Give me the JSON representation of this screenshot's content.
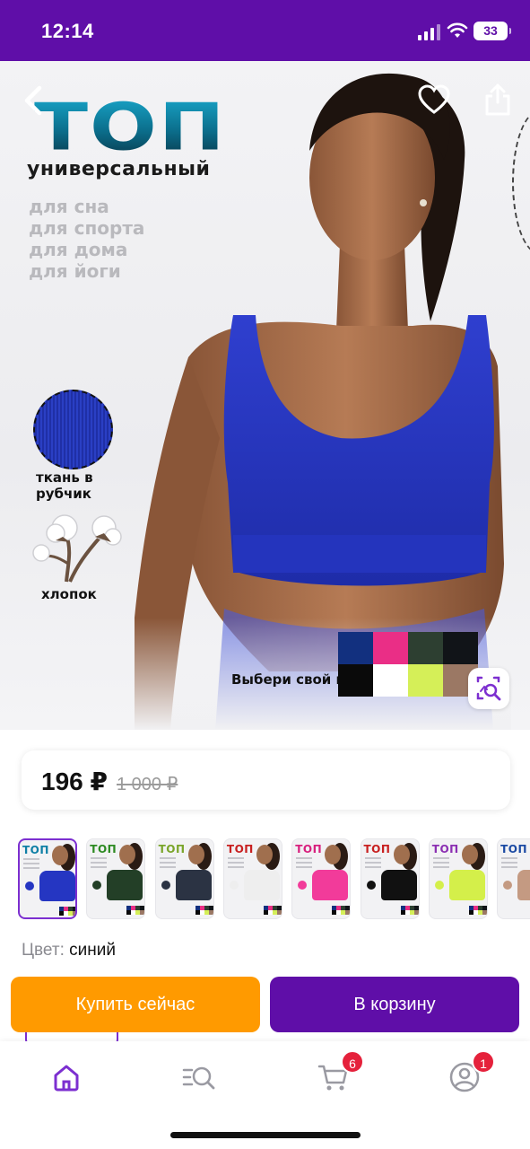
{
  "status_bar": {
    "time": "12:14",
    "battery": "33"
  },
  "product_image": {
    "title": "ТОП",
    "subtitle": "универсальный",
    "uses": [
      "для сна",
      "для спорта",
      "для дома",
      "для йоги"
    ],
    "fabric_label": "ткань в рубчик",
    "cotton_label": "хлопок",
    "choose_color_label": "Выбери свой цвет",
    "palette_colors": [
      "#12307f",
      "#ea2e86",
      "#2d3f31",
      "#111418",
      "#0a0a0a",
      "#ffffff",
      "#d5ef58",
      "#9b7864"
    ]
  },
  "price": {
    "current": "196 ₽",
    "old": "1 000 ₽"
  },
  "variants": [
    {
      "title_color": "#0d7fa5",
      "top_color": "#2536c2",
      "selected": true
    },
    {
      "title_color": "#2d8a22",
      "top_color": "#233f27"
    },
    {
      "title_color": "#7aa52a",
      "top_color": "#2b3343"
    },
    {
      "title_color": "#c82020",
      "top_color": "#eeeeee"
    },
    {
      "title_color": "#d8207e",
      "top_color": "#f23b9a"
    },
    {
      "title_color": "#c82020",
      "top_color": "#111111"
    },
    {
      "title_color": "#8b2fb2",
      "top_color": "#d4ef4a"
    },
    {
      "title_color": "#1b4aa3",
      "top_color": "#c49a82"
    }
  ],
  "color": {
    "label": "Цвет:",
    "value": "синий"
  },
  "actions": {
    "buy_now": "Купить сейчас",
    "add_to_cart": "В корзину"
  },
  "tabbar": {
    "cart_badge": "6",
    "profile_badge": "1"
  },
  "colors": {
    "brand_purple": "#5f0ea8",
    "accent_orange": "#ff9a00",
    "badge_red": "#e5213b"
  }
}
